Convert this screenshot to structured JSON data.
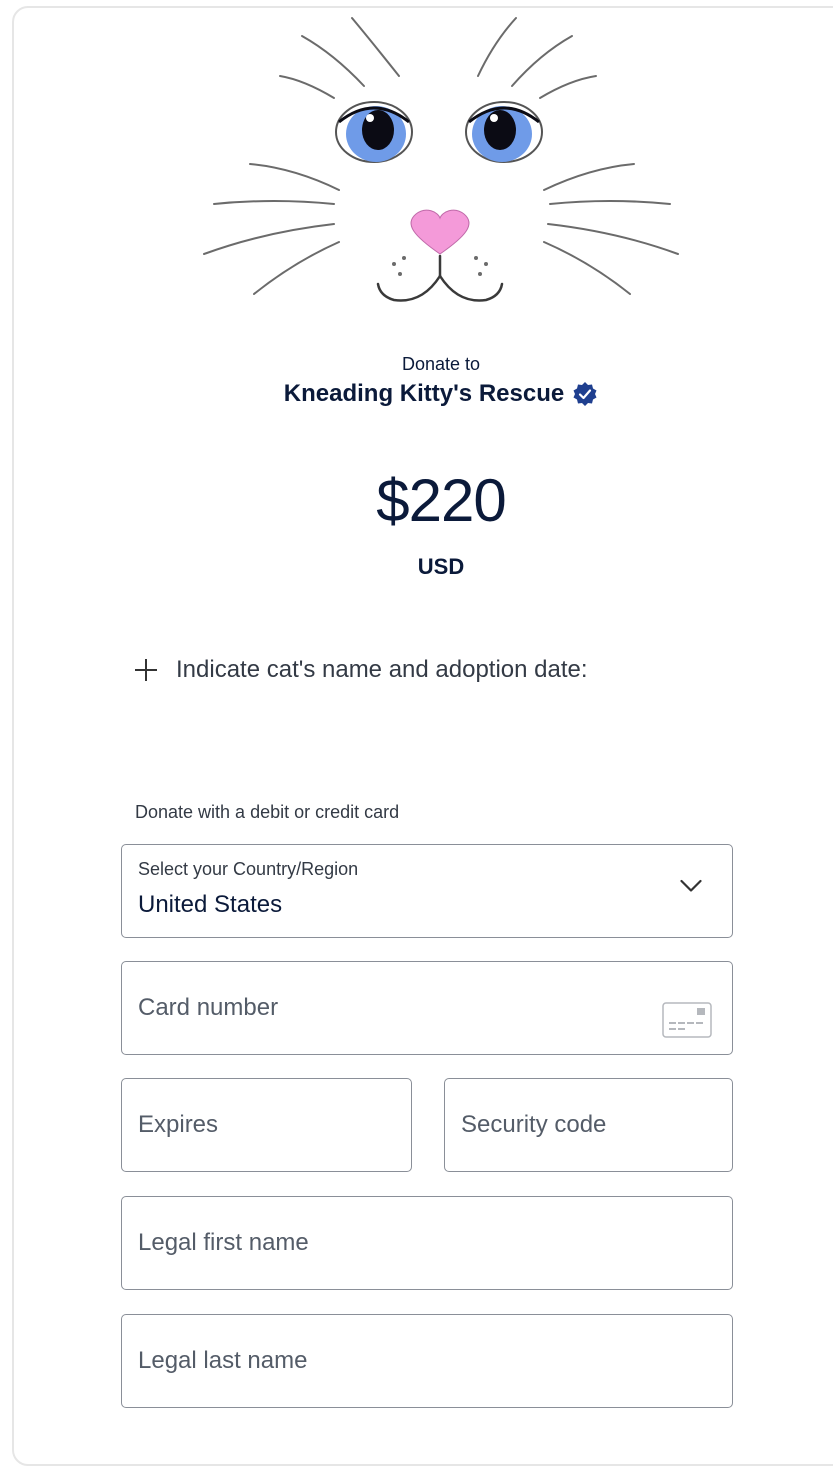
{
  "header": {
    "donate_to_label": "Donate to",
    "org_name": "Kneading Kitty's Rescue",
    "verified_icon": "verified-badge-icon",
    "logo_icon": "cat-face-logo"
  },
  "donation": {
    "amount": "$220",
    "currency": "USD"
  },
  "note": {
    "label": "Indicate cat's name and adoption date:",
    "icon": "plus-icon"
  },
  "payment": {
    "section_label": "Donate with a debit or credit card",
    "country": {
      "caption": "Select your Country/Region",
      "value": "United States",
      "icon": "chevron-down-icon"
    },
    "card_number_placeholder": "Card number",
    "card_icon": "credit-card-icon",
    "expires_placeholder": "Expires",
    "security_placeholder": "Security code",
    "first_name_placeholder": "Legal first name",
    "last_name_placeholder": "Legal last name"
  },
  "colors": {
    "text_primary": "#0b1a3a",
    "verified_badge": "#1f3f8f",
    "eye_iris": "#6f9be8",
    "nose": "#f49ad9",
    "field_border": "#8a8f98"
  }
}
